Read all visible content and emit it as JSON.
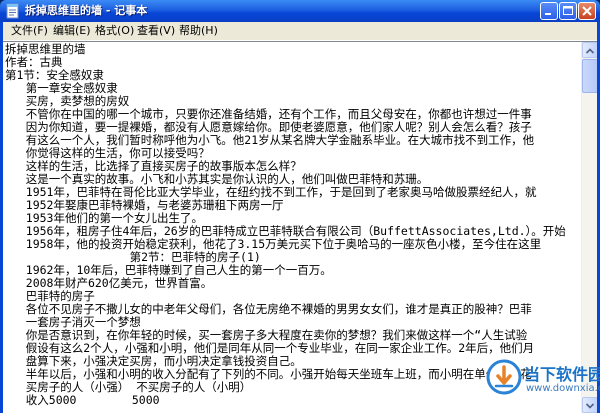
{
  "window": {
    "title": "拆掉思维里的墙 - 记事本"
  },
  "menu": {
    "items": [
      "文件(F)",
      "编辑(E)",
      "格式(O)",
      "查看(V)",
      "帮助(H)"
    ]
  },
  "lines": [
    "拆掉思维里的墙",
    "作者：古典",
    "第1节：安全感奴隶",
    "   第一章安全感奴隶",
    "   买房，卖梦想的房奴",
    "   不管你在中国的哪一个城市，只要你还准备结婚，还有个工作，而且父母安在，你都也许想过一件事",
    "   因为你知道，要一提裸婚，都没有人愿意嫁给你。即使老婆愿意，他们家人呢？别人会怎么看？孩子",
    "   有这么一个人，我们暂时称呼他为小飞。他21岁从某名牌大学金融系毕业。在大城市找不到工作，他",
    "   你觉得这样的生活，你可以接受吗？",
    "   这样的生活，比选择了直接买房子的故事版本怎么样？",
    "   这是一个真实的故事。小飞和小苏其实是你认识的人，他们叫做巴菲特和苏珊。",
    "   1951年，巴菲特在哥伦比亚大学毕业，在纽约找不到工作，于是回到了老家奥马哈做股票经纪人，就",
    "   1952年娶康巴菲特裸婚，与老婆苏珊租下两房一厅",
    "   1953年他们的第一个女儿出生了。",
    "   1956年，租房子住4年后，26岁的巴菲特成立巴菲特联合有限公司（BuffettAssociates,Ltd.）。开始",
    "   1958年，他的投资开始稳定获利，他花了3.15万美元买下位于奥哈马的一座灰色小楼，至今住在这里",
    "                  第2节：巴菲特的房子(1)",
    "   1962年，10年后，巴菲特赚到了自己人生的第一个一百万。",
    "   2008年财产620亿美元，世界首富。",
    "   巴菲特的房子",
    "   各位不见房子不撒儿女的中老年父母们，各位无房绝不裸婚的男男女女们，谁才是真正的股神？巴菲",
    "   一套房子消灭一个梦想",
    "   你是否意识到，在你年轻的时候，买一套房子多大程度在卖你的梦想？我们来做这样一个“人生试验",
    "   假设有这么2个人，小强和小明，他们是同年从同一个专业毕业，在同一家企业工作。2年后，他们月",
    "   盘算下来，小强决定买房，而小明决定拿钱投资自己。",
    "   半年以后，小强和小明的收入分配有了下列的不同。小强开始每天坐班车上班，而小明在单位附近花",
    "   买房子的人（小强） 不买房子的人（小明）",
    "   收入5000        5000"
  ],
  "watermark": {
    "main": "当下软件园",
    "sub": "www.downxia.com"
  },
  "colors": {
    "titlebar": "#0846d8",
    "menu_bg": "#ece9d8",
    "editor_bg": "#ffffff",
    "close": "#c8421f"
  }
}
